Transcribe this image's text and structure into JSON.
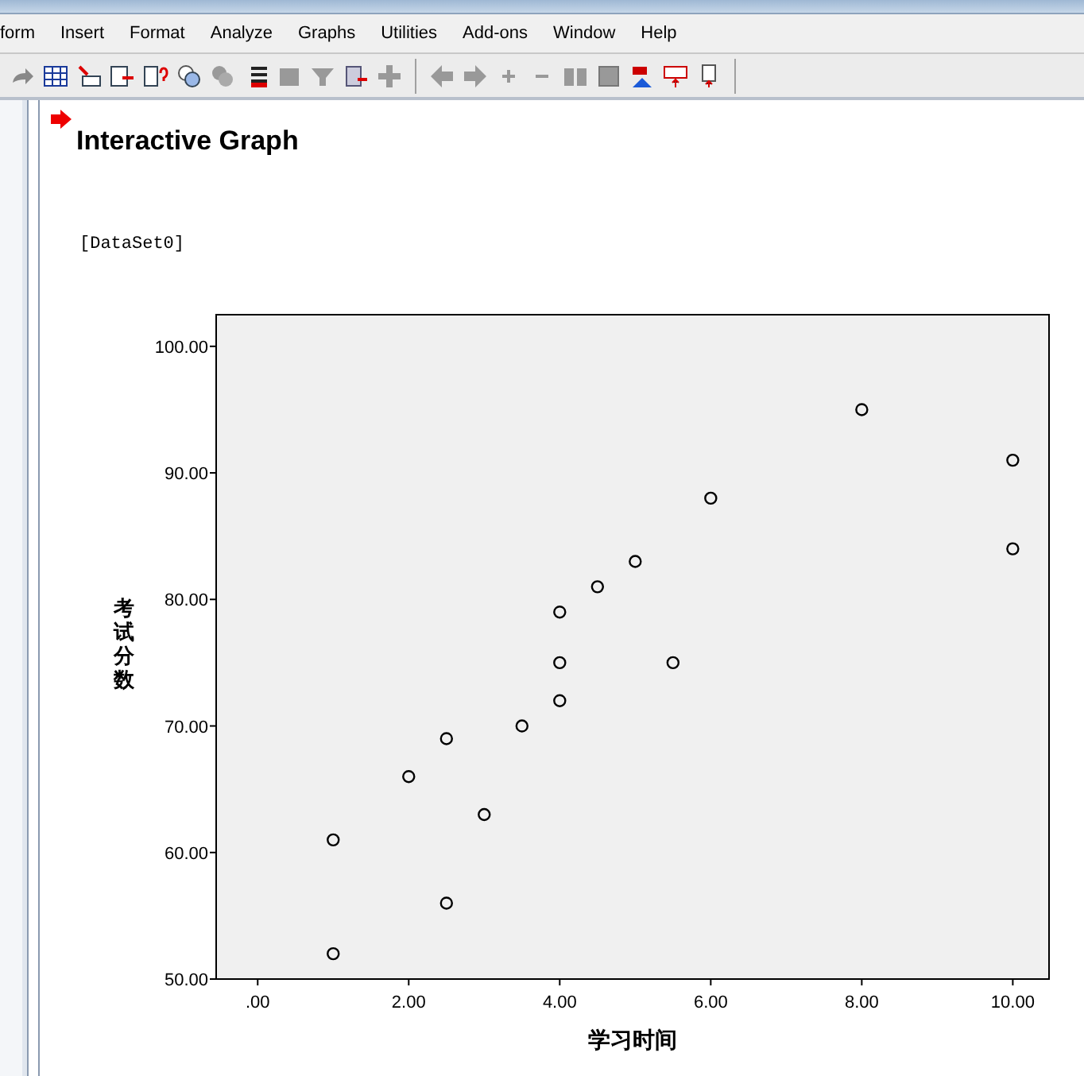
{
  "menu": [
    "form",
    "Insert",
    "Format",
    "Analyze",
    "Graphs",
    "Utilities",
    "Add-ons",
    "Window",
    "Help"
  ],
  "output": {
    "heading": "Interactive Graph",
    "dataset": "[DataSet0]"
  },
  "chart": {
    "chart_data": {
      "type": "scatter",
      "xlabel": "学习时间",
      "ylabel": "考试分数",
      "x": [
        1,
        1,
        2,
        2.5,
        2.5,
        3,
        3.5,
        4,
        4,
        4,
        4.5,
        5,
        5.5,
        6,
        8,
        10,
        10
      ],
      "series": [
        {
          "color": "#000000",
          "values": [
            52,
            61,
            66,
            56,
            69,
            63,
            70,
            72,
            75,
            79,
            81,
            83,
            75,
            88,
            95,
            91,
            84
          ]
        }
      ],
      "xlim": [
        -0.55,
        10.48
      ],
      "ylim": [
        50,
        102.5
      ],
      "xticks": [
        {
          "value": 0,
          "label": ".00"
        },
        {
          "value": 2,
          "label": "2.00"
        },
        {
          "value": 4,
          "label": "4.00"
        },
        {
          "value": 6,
          "label": "6.00"
        },
        {
          "value": 8,
          "label": "8.00"
        },
        {
          "value": 10,
          "label": "10.00"
        }
      ],
      "yticks": [
        {
          "value": 50,
          "label": "50.00"
        },
        {
          "value": 60,
          "label": "60.00"
        },
        {
          "value": 70,
          "label": "70.00"
        },
        {
          "value": 80,
          "label": "80.00"
        },
        {
          "value": 90,
          "label": "90.00"
        },
        {
          "value": 100,
          "label": "100.00"
        }
      ]
    }
  }
}
